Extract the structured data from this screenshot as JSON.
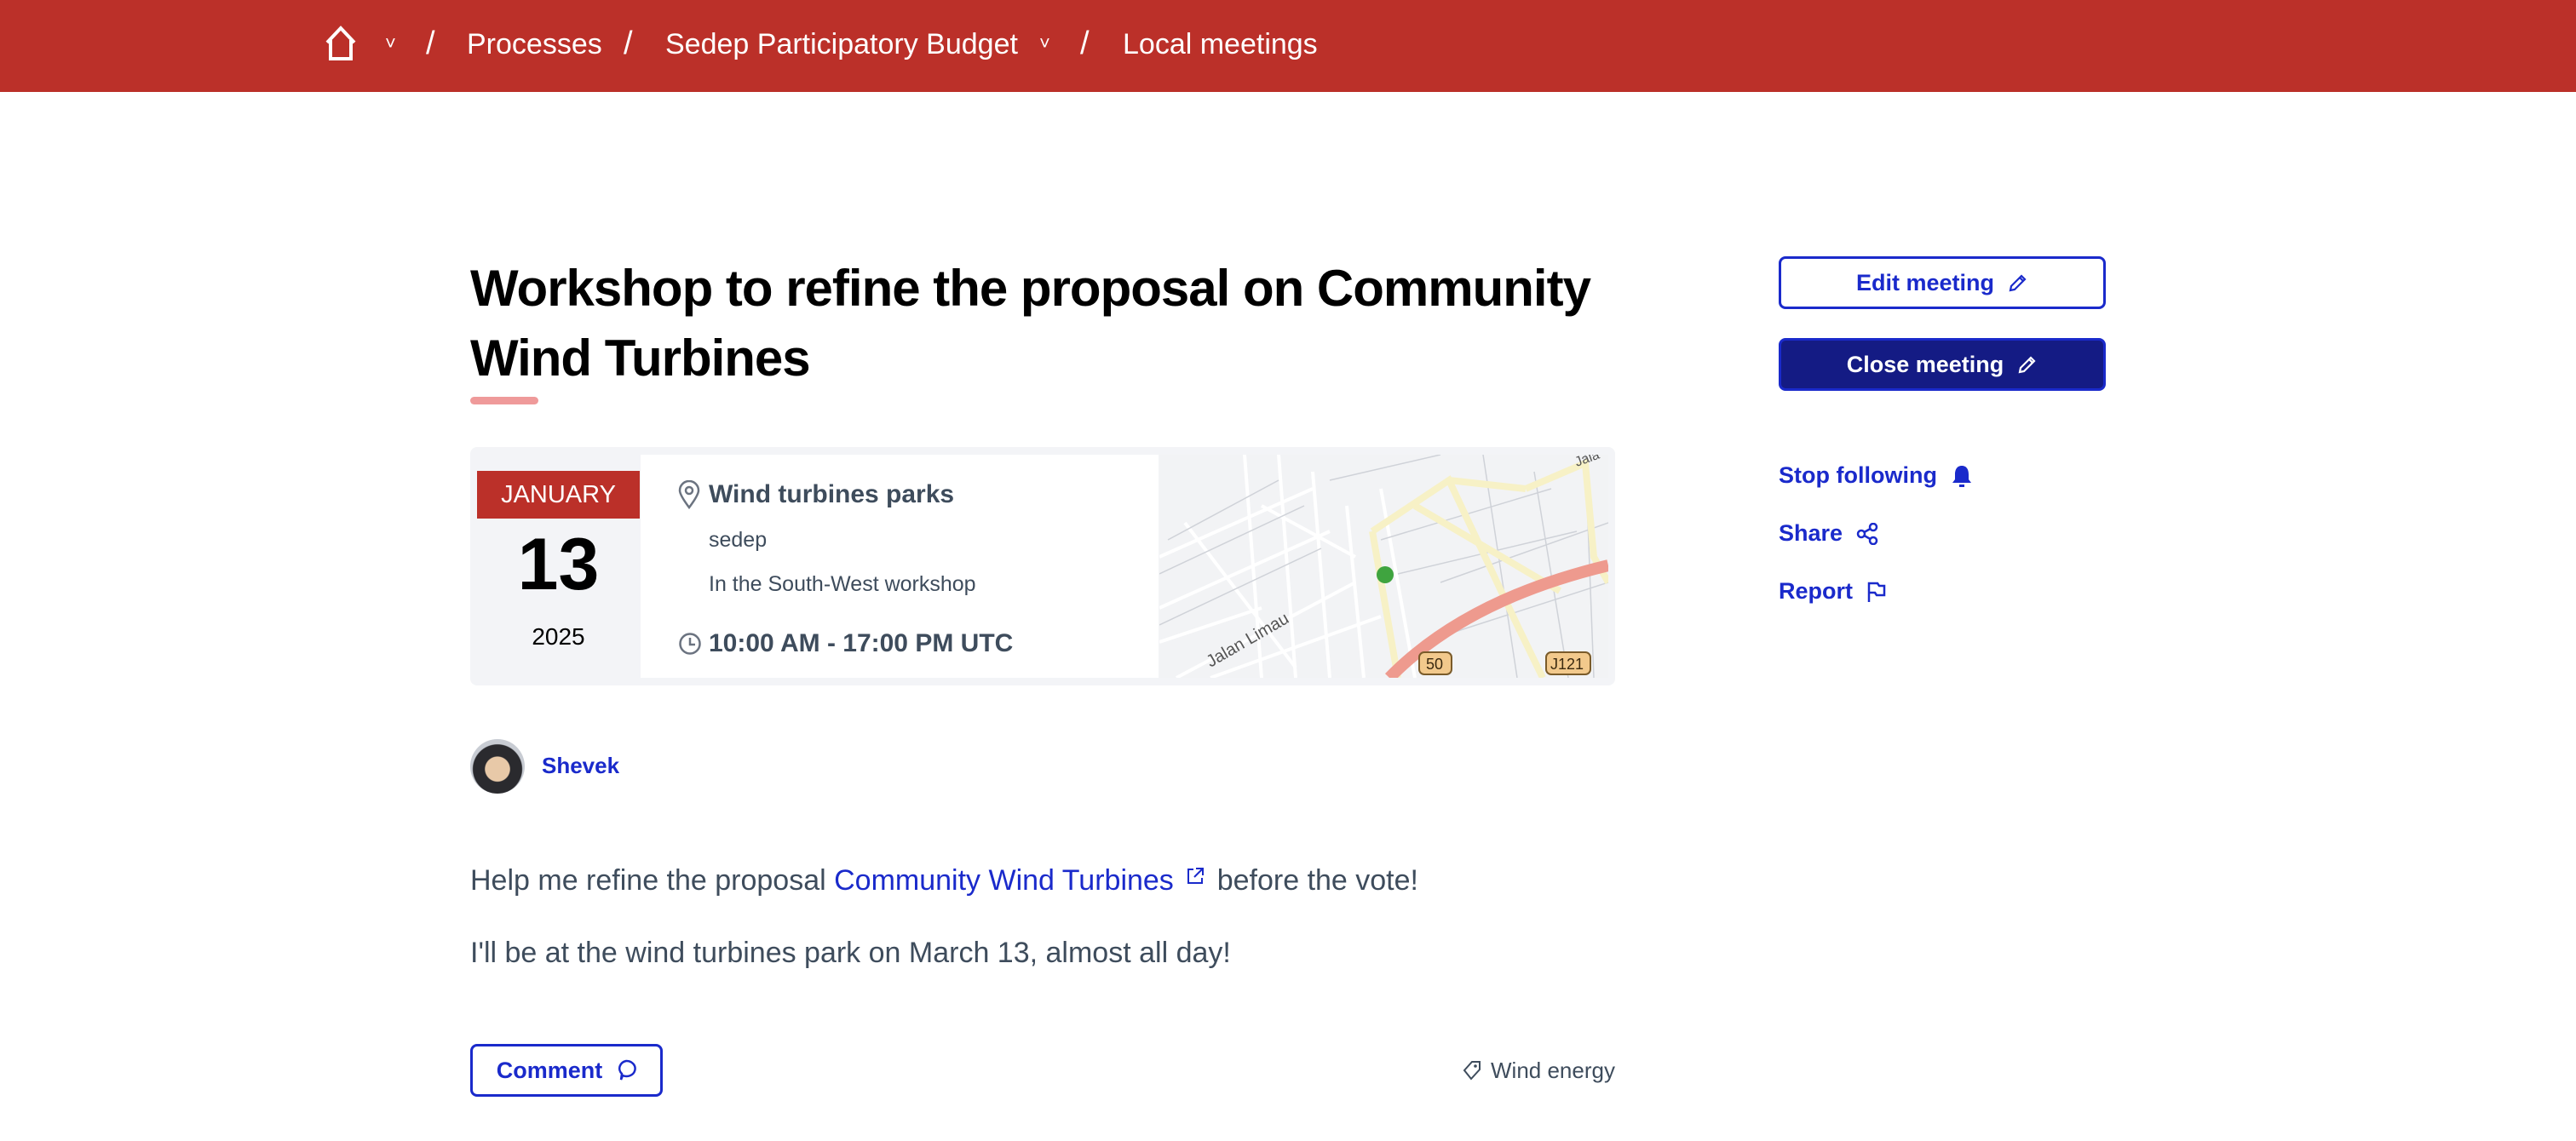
{
  "header": {
    "bg": "#bb3029",
    "breadcrumb": [
      {
        "icon": "home-icon"
      },
      {
        "label": "Processes"
      },
      {
        "label": "Sedep Participatory Budget"
      },
      {
        "label": "Local meetings"
      }
    ],
    "separator": "/"
  },
  "meeting": {
    "title": "Workshop to refine the proposal on Community Wind Turbines",
    "date": {
      "month": "JANUARY",
      "day": "13",
      "year": "2025"
    },
    "location": {
      "name": "Wind turbines parks",
      "address": "sedep",
      "hints": "In the South-West workshop"
    },
    "time": "10:00 AM - 17:00 PM UTC",
    "map": {
      "street_label": "Jalan Limau",
      "route_badges": [
        "50",
        "J121"
      ],
      "corner_label": "Jala"
    },
    "author": {
      "name": "Shevek"
    },
    "description": {
      "line1_before": "Help me refine the proposal ",
      "line1_link": "Community Wind Turbines ",
      "line1_after": " before the vote!",
      "line2": "I'll be at the wind turbines park on March 13, almost all day!"
    },
    "comment_label": "Comment",
    "tag": "Wind energy"
  },
  "sidebar": {
    "edit_label": "Edit meeting",
    "close_label": "Close meeting",
    "follow_label": "Stop following",
    "share_label": "Share",
    "report_label": "Report"
  },
  "colors": {
    "primary": "#1a2acb",
    "dark_button": "#141b84",
    "accent": "#bb3029"
  }
}
